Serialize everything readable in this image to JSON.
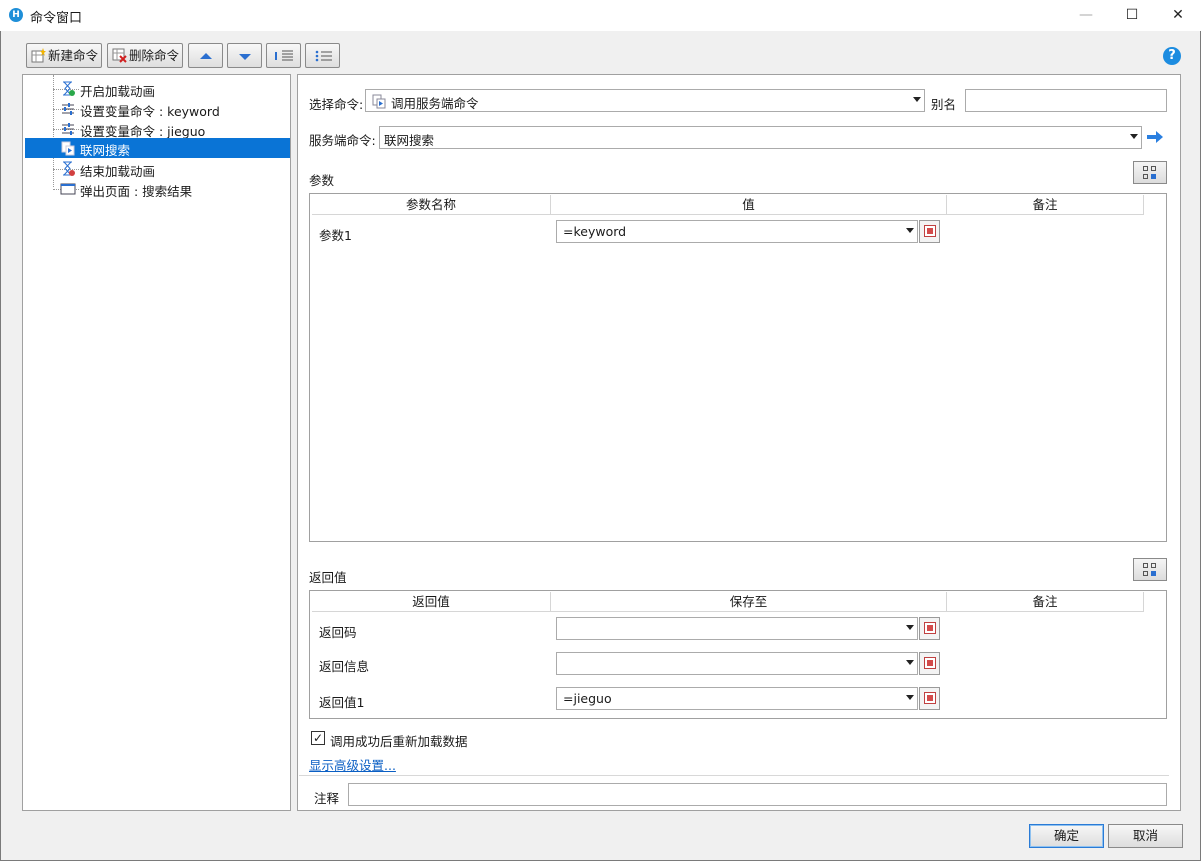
{
  "window": {
    "title": "命令窗口",
    "app_icon": "H",
    "minimize": "—",
    "maximize": "☐",
    "close": "✕"
  },
  "toolbar": {
    "new_command": "新建命令",
    "delete_command": "删除命令",
    "help": "?"
  },
  "tree": {
    "items": [
      {
        "label": "开启加载动画",
        "icon": "hourglass-start-icon"
      },
      {
        "label": "设置变量命令 : keyword",
        "icon": "set-variable-icon"
      },
      {
        "label": "设置变量命令 : jieguo",
        "icon": "set-variable-icon"
      },
      {
        "label": "联网搜索",
        "icon": "server-command-icon",
        "selected": true
      },
      {
        "label": "结束加载动画",
        "icon": "hourglass-end-icon"
      },
      {
        "label": "弹出页面 : 搜索结果",
        "icon": "popup-page-icon"
      }
    ]
  },
  "form": {
    "select_command_label": "选择命令:",
    "select_command_value": "调用服务端命令",
    "alias_label": "别名",
    "alias_value": "",
    "server_command_label": "服务端命令:",
    "server_command_value": "联网搜索",
    "params_section": "参数",
    "params_columns": [
      "参数名称",
      "值",
      "备注"
    ],
    "params_rows": [
      {
        "name": "参数1",
        "value": "=keyword",
        "note": ""
      }
    ],
    "returns_section": "返回值",
    "returns_columns": [
      "返回值",
      "保存至",
      "备注"
    ],
    "returns_rows": [
      {
        "name": "返回码",
        "value": "",
        "note": ""
      },
      {
        "name": "返回信息",
        "value": "",
        "note": ""
      },
      {
        "name": "返回值1",
        "value": "=jieguo",
        "note": ""
      }
    ],
    "reload_checkbox_label": "调用成功后重新加载数据",
    "reload_checked": true,
    "advanced_link": "显示高级设置...",
    "comment_label": "注释",
    "comment_value": ""
  },
  "buttons": {
    "ok": "确定",
    "cancel": "取消"
  },
  "colors": {
    "selection": "#0a74d6",
    "link": "#0b5fc4",
    "help": "#1c8ce0"
  }
}
